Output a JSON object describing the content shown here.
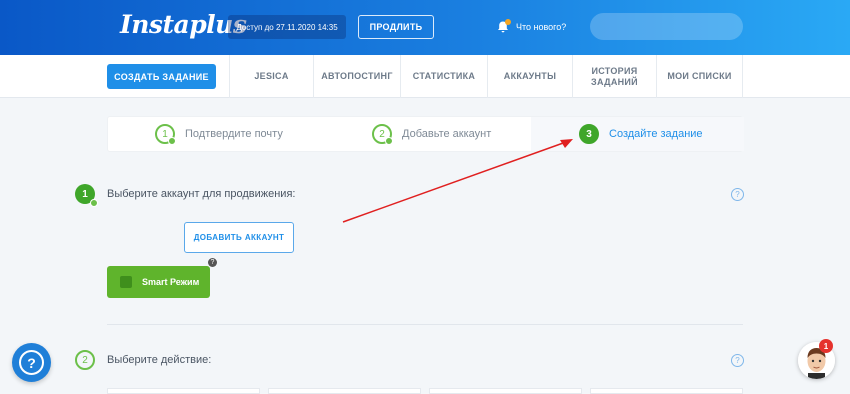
{
  "header": {
    "logo": "Instaplus",
    "access_text": "Доступ до 27.11.2020 14:35",
    "renew_label": "ПРОДЛИТЬ",
    "news_label": "Что нового?"
  },
  "nav": {
    "create_task_label": "СОЗДАТЬ ЗАДАНИЕ",
    "items": [
      {
        "label": "JESICA"
      },
      {
        "label": "АВТОПОСТИНГ"
      },
      {
        "label": "СТАТИСТИКА"
      },
      {
        "label": "АККАУНТЫ"
      },
      {
        "label": "ИСТОРИЯ\nЗАДАНИЙ"
      },
      {
        "label": "МОИ СПИСКИ"
      }
    ]
  },
  "steps": [
    {
      "number": "1",
      "label": "Подтвердите почту"
    },
    {
      "number": "2",
      "label": "Добавьте аккаунт"
    },
    {
      "number": "3",
      "label": "Создайте задание"
    }
  ],
  "section1": {
    "number": "1",
    "title": "Выберите аккаунт для продвижения:",
    "add_account_label": "ДОБАВИТЬ АККАУНТ",
    "smart_mode_label": "Smart Режим",
    "help_mark": "?"
  },
  "section2": {
    "number": "2",
    "title": "Выберите действие:",
    "help_mark": "?"
  },
  "floating": {
    "help_mark": "?",
    "chat_badge_count": "1"
  },
  "colors": {
    "header_start": "#0a58c7",
    "header_end": "#2aa9f5",
    "accent_blue": "#1f8fe8",
    "accent_green": "#5fb42c",
    "annotation_arrow": "#e02020"
  }
}
